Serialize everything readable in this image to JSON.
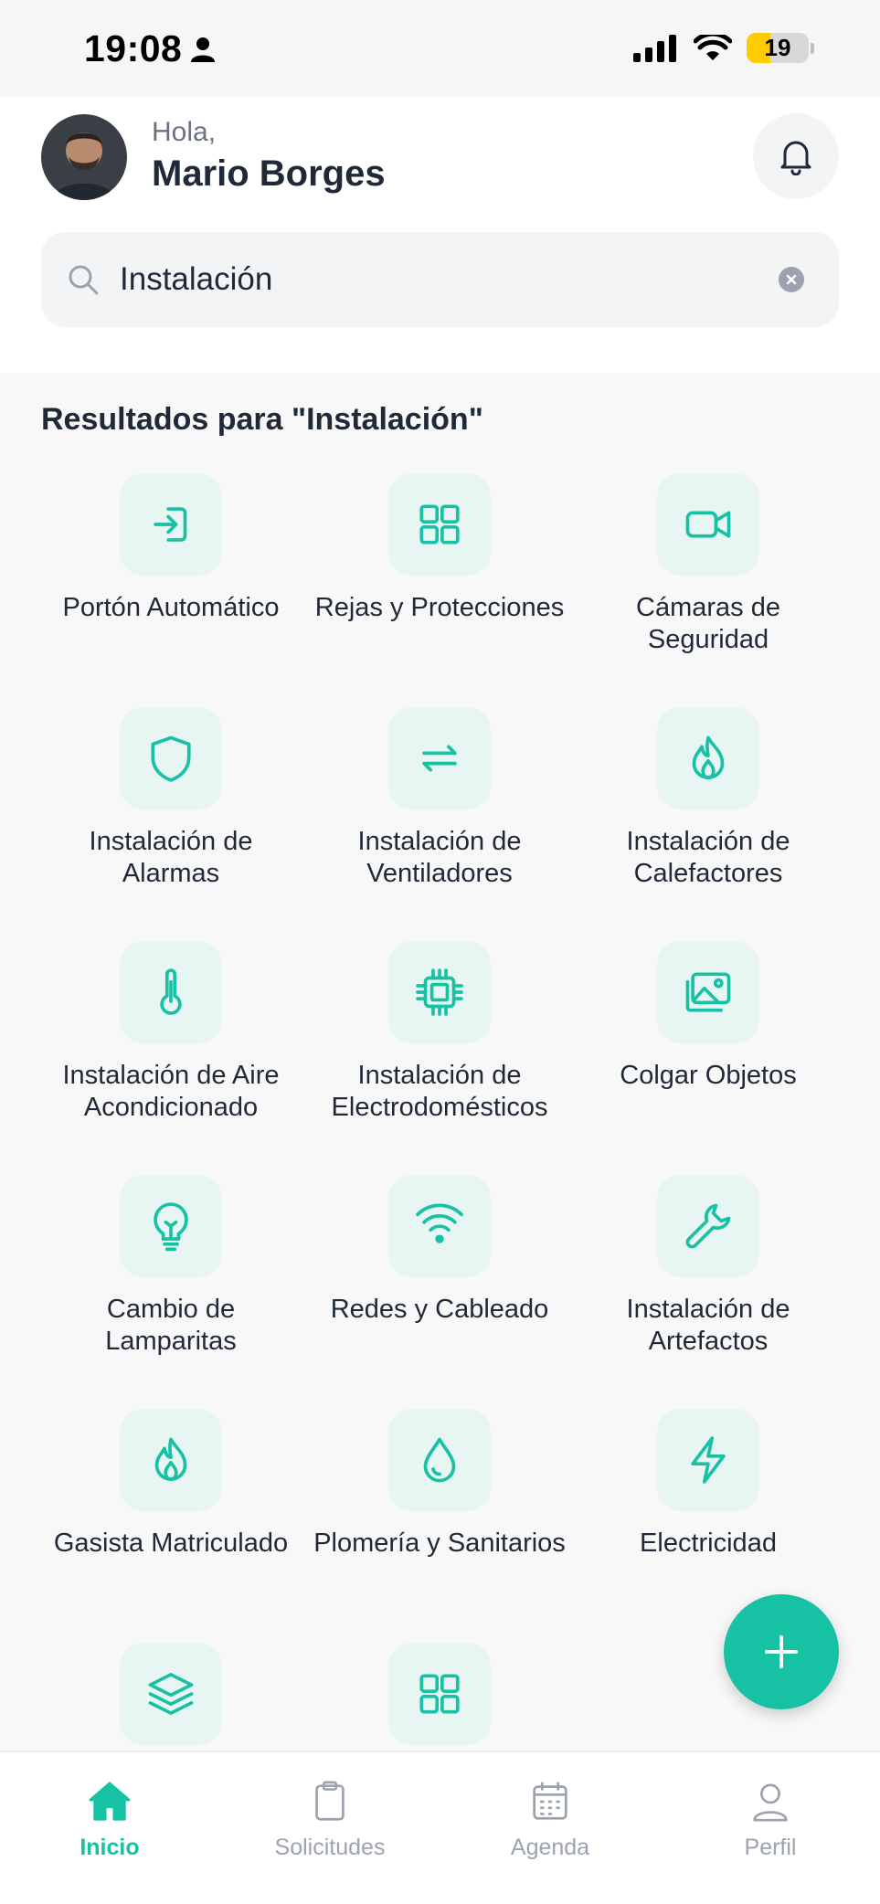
{
  "status_bar": {
    "time": "19:08",
    "battery": "19",
    "icons": [
      "person-icon",
      "signal-icon",
      "wifi-icon",
      "battery-icon"
    ]
  },
  "header": {
    "greeting": "Hola,",
    "user_name": "Mario Borges"
  },
  "search": {
    "value": "Instalación",
    "placeholder": ""
  },
  "results": {
    "title": "Resultados para \"Instalación\"",
    "items": [
      {
        "label": "Portón Automático",
        "icon": "login-arrow-icon"
      },
      {
        "label": "Rejas y Protecciones",
        "icon": "grid-icon"
      },
      {
        "label": "Cámaras de Seguridad",
        "icon": "video-camera-icon"
      },
      {
        "label": "Instalación de Alarmas",
        "icon": "shield-icon"
      },
      {
        "label": "Instalación de Ventiladores",
        "icon": "repeat-arrows-icon"
      },
      {
        "label": "Instalación de Calefactores",
        "icon": "flame-icon"
      },
      {
        "label": "Instalación de Aire Acondicionado",
        "icon": "thermometer-icon"
      },
      {
        "label": "Instalación de Electrodomésticos",
        "icon": "chip-icon"
      },
      {
        "label": "Colgar Objetos",
        "icon": "pictures-icon"
      },
      {
        "label": "Cambio de Lamparitas",
        "icon": "lightbulb-icon"
      },
      {
        "label": "Redes y Cableado",
        "icon": "wifi-icon"
      },
      {
        "label": "Instalación de Artefactos",
        "icon": "wrench-icon"
      },
      {
        "label": "Gasista Matriculado",
        "icon": "flame-icon"
      },
      {
        "label": "Plomería y Sanitarios",
        "icon": "droplet-icon"
      },
      {
        "label": "Electricidad",
        "icon": "lightning-icon"
      },
      {
        "label": "",
        "icon": "layers-icon"
      },
      {
        "label": "",
        "icon": "grid-icon"
      }
    ]
  },
  "bottom_nav": {
    "items": [
      {
        "label": "Inicio",
        "icon": "home-icon",
        "active": true
      },
      {
        "label": "Solicitudes",
        "icon": "clipboard-icon",
        "active": false
      },
      {
        "label": "Agenda",
        "icon": "calendar-icon",
        "active": false
      },
      {
        "label": "Perfil",
        "icon": "user-icon",
        "active": false
      }
    ]
  },
  "colors": {
    "accent": "#16c2a3",
    "tile_bg": "#e7f6f3",
    "text_primary": "#1f2937",
    "text_muted": "#9ca3af",
    "battery": "#ffcc00"
  }
}
